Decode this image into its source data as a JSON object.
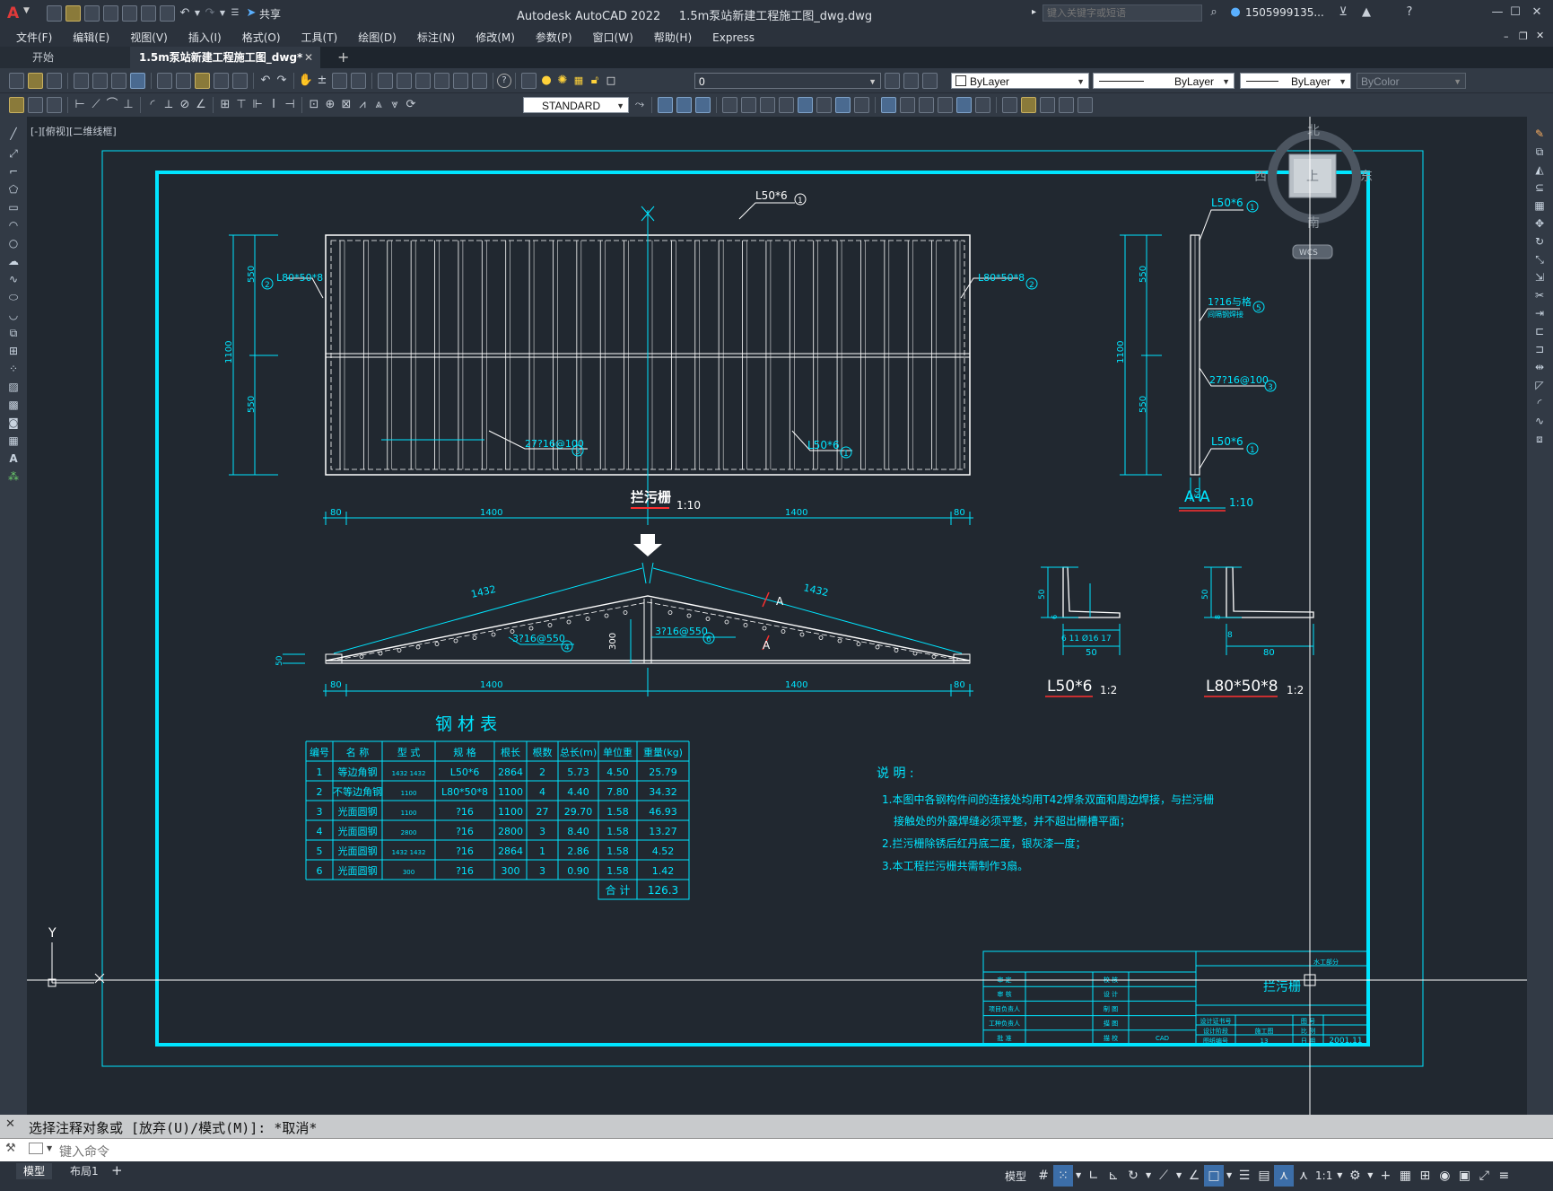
{
  "app": {
    "title": "Autodesk AutoCAD 2022",
    "filename": "1.5m泵站新建工程施工图_dwg.dwg",
    "share_label": "共享",
    "search_placeholder": "键入关键字或短语",
    "user": "1505999135...",
    "app_letter": "A"
  },
  "menu": [
    "文件(F)",
    "编辑(E)",
    "视图(V)",
    "插入(I)",
    "格式(O)",
    "工具(T)",
    "绘图(D)",
    "标注(N)",
    "修改(M)",
    "参数(P)",
    "窗口(W)",
    "帮助(H)",
    "Express"
  ],
  "tabs": {
    "start": "开始",
    "doc": "1.5m泵站新建工程施工图_dwg*",
    "add": "+"
  },
  "toolbar": {
    "layer": "0",
    "color": "ByLayer",
    "linetype": "ByLayer",
    "lineweight": "ByLayer",
    "plotstyle": "ByColor",
    "textstyle": "STANDARD"
  },
  "viewport": {
    "label": "[-][俯视][二维线框]",
    "viewcube": {
      "north": "北",
      "south": "南",
      "east": "东",
      "west": "西",
      "top": "上",
      "wcs": "WCS"
    },
    "ucs": {
      "y": "Y",
      "x": "X"
    }
  },
  "drawing": {
    "plan_labels": {
      "top_angle": "L50*6",
      "left_angle": "L80*50*8",
      "right_angle": "L80*50*8",
      "bottom_angle": "L50*6",
      "bars": "27?16@100",
      "circ1": "1",
      "circ2": "2",
      "circ3": "3",
      "dim_550a": "550",
      "dim_550b": "550",
      "dim_1100": "1100",
      "dim_80a": "80",
      "dim_1400a": "1400",
      "dim_1400b": "1400",
      "dim_80b": "80"
    },
    "plan_title": "拦污栅",
    "plan_scale": "1:10",
    "section": {
      "top": "L50*6",
      "mid1": "1?16与格",
      "mid2": "间隔钢焊接",
      "bars": "27?16@100",
      "bottom": "L50*6",
      "c1": "1",
      "c5": "5",
      "c3": "3",
      "c1b": "1",
      "dim_550a": "550",
      "dim_550b": "550",
      "dim_1100": "1100",
      "dim_50": "50",
      "title": "A-A",
      "scale": "1:10"
    },
    "elevation": {
      "len_left": "1432",
      "len_right": "1432",
      "height": "300",
      "bars_left": "3?16@550",
      "bars_right": "3?16@550",
      "c4": "4",
      "c6": "6",
      "cut_a1": "A",
      "cut_a2": "A",
      "dim_50": "50",
      "dim_80a": "80",
      "dim_1400a": "1400",
      "dim_1400b": "1400",
      "dim_80b": "80"
    },
    "profile1": {
      "title": "L50*6",
      "scale": "1:2",
      "h": "50",
      "t": "6",
      "w": "50",
      "dims": "6 11 Ø16 17"
    },
    "profile2": {
      "title": "L80*50*8",
      "scale": "1:2",
      "h": "50",
      "t": "8",
      "w": "80",
      "lip": "8"
    },
    "table": {
      "title": "钢 材 表",
      "headers": [
        "编号",
        "名 称",
        "型 式",
        "规 格",
        "根长",
        "根数",
        "总长(m)",
        "单位重",
        "重量(kg)"
      ],
      "rows": [
        [
          "1",
          "等边角钢",
          "1432 1432",
          "L50*6",
          "2864",
          "2",
          "5.73",
          "4.50",
          "25.79"
        ],
        [
          "2",
          "不等边角钢",
          "1100",
          "L80*50*8",
          "1100",
          "4",
          "4.40",
          "7.80",
          "34.32"
        ],
        [
          "3",
          "光面圆钢",
          "1100",
          "?16",
          "1100",
          "27",
          "29.70",
          "1.58",
          "46.93"
        ],
        [
          "4",
          "光面圆钢",
          "2800",
          "?16",
          "2800",
          "3",
          "8.40",
          "1.58",
          "13.27"
        ],
        [
          "5",
          "光面圆钢",
          "1432 1432",
          "?16",
          "2864",
          "1",
          "2.86",
          "1.58",
          "4.52"
        ],
        [
          "6",
          "光面圆钢",
          "300",
          "?16",
          "300",
          "3",
          "0.90",
          "1.58",
          "1.42"
        ]
      ],
      "total_label": "合 计",
      "total_value": "126.3"
    },
    "notes": {
      "title": "说 明 :",
      "lines": [
        "1.本图中各钢构件间的连接处均用T42焊条双面和周边焊接，与拦污栅",
        "接触处的外露焊缝必须平整，并不超出栅槽平面；",
        "2.拦污栅除锈后红丹底二度，银灰漆一度；",
        "3.本工程拦污栅共需制作3扇。"
      ]
    },
    "titleblock": {
      "name": "拦污栅",
      "top_right": "水工部分",
      "left_rows": [
        [
          "审 定",
          "",
          "校 核",
          ""
        ],
        [
          "审 核",
          "",
          "设 计",
          ""
        ],
        [
          "项目负责人",
          "",
          "制 图",
          ""
        ],
        [
          "工种负责人",
          "",
          "描 图",
          ""
        ],
        [
          "批 准",
          "",
          "描 校",
          "CAD"
        ]
      ],
      "right_rows": [
        [
          "设计证书号",
          "",
          "图 号",
          ""
        ],
        [
          "设计阶段",
          "施工图",
          "比 例",
          ""
        ],
        [
          "图纸编号",
          "13",
          "日 期",
          "2001.11"
        ]
      ]
    }
  },
  "command": {
    "history": "选择注释对象或 [放弃(U)/模式(M)]: *取消*",
    "placeholder": "键入命令"
  },
  "status": {
    "layout_tabs": [
      "模型",
      "布局1"
    ],
    "add": "+",
    "model": "模型",
    "scale": "1:1"
  }
}
